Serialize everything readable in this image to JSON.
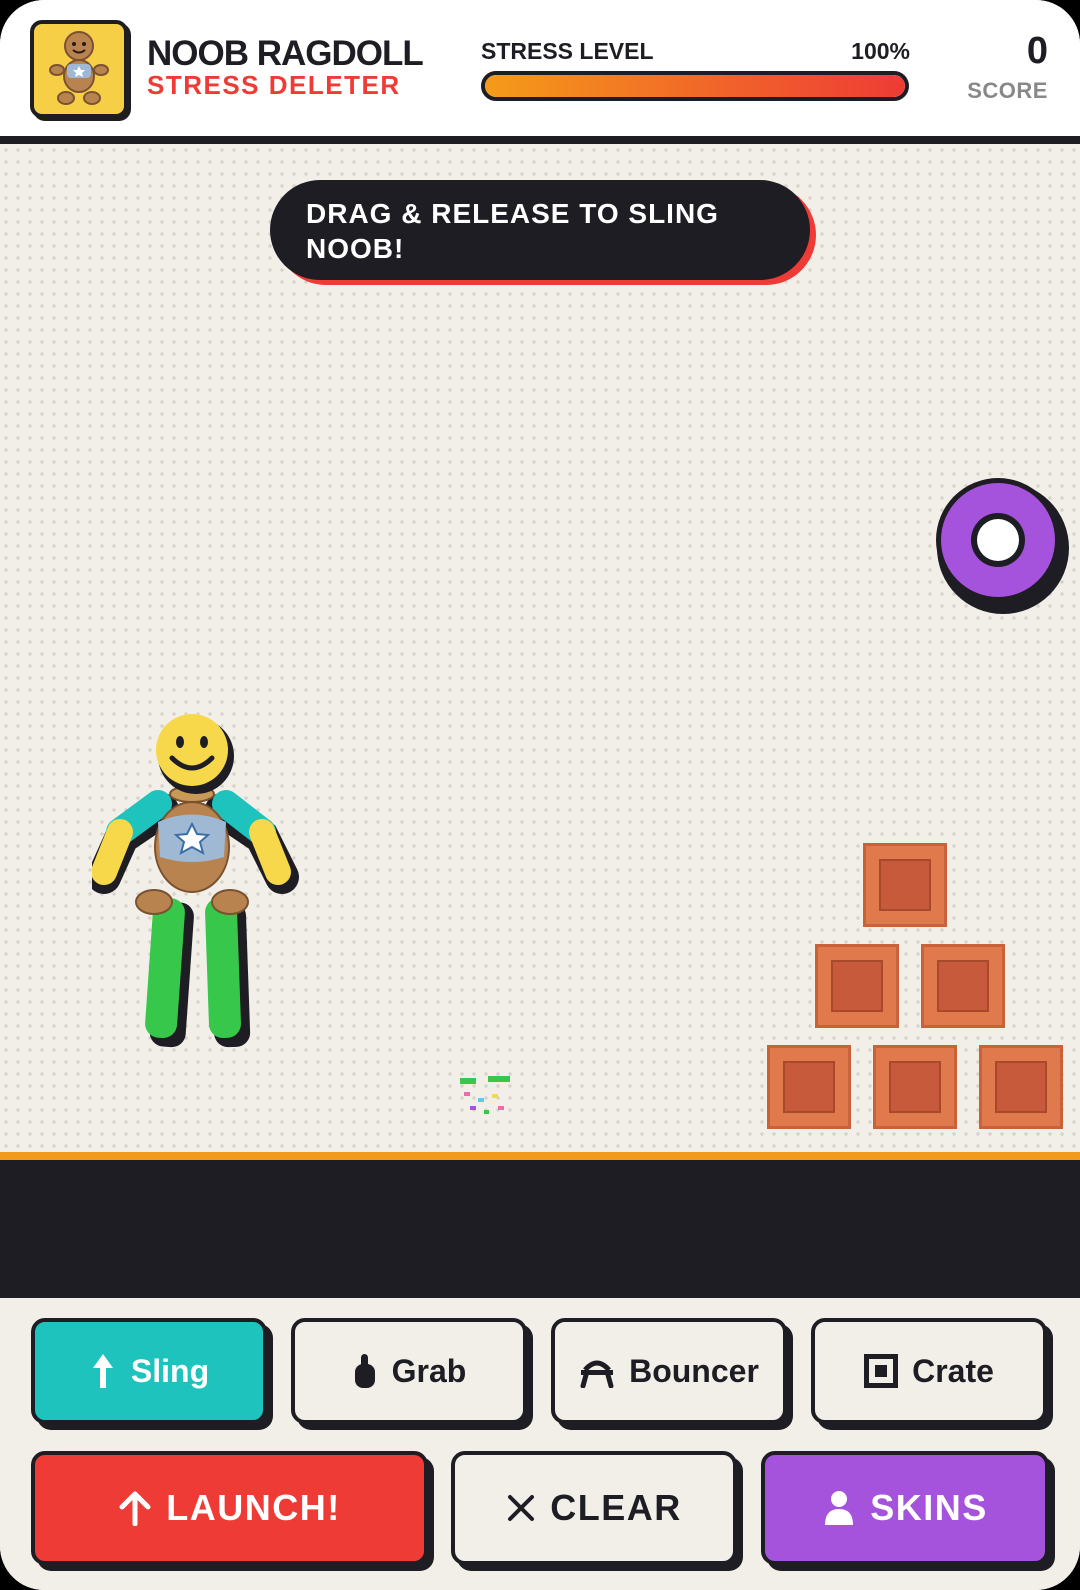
{
  "header": {
    "title": "NOOB RAGDOLL",
    "subtitle": "STRESS DELETER",
    "stress_label": "STRESS LEVEL",
    "stress_value": "100%",
    "stress_level": 1.0,
    "score": "0",
    "score_label": "SCORE"
  },
  "hint": "DRAG & RELEASE TO SLING NOOB!",
  "tools": [
    {
      "label": "Sling",
      "icon": "arrow-up-icon",
      "active": true
    },
    {
      "label": "Grab",
      "icon": "hand-icon",
      "active": false
    },
    {
      "label": "Bouncer",
      "icon": "bouncer-icon",
      "active": false
    },
    {
      "label": "Crate",
      "icon": "crate-icon",
      "active": false
    }
  ],
  "actions": [
    {
      "label": "LAUNCH!",
      "icon": "arrow-up-icon"
    },
    {
      "label": "CLEAR",
      "icon": "close-icon"
    },
    {
      "label": "SKINS",
      "icon": "person-icon"
    }
  ],
  "colors": {
    "dark": "#1e1d23",
    "accent_red": "#ee3b35",
    "teal": "#1fc3bd",
    "purple": "#a552dc",
    "orange": "#f29a1c",
    "crate": "#e07a4d",
    "background": "#f2efe9"
  }
}
